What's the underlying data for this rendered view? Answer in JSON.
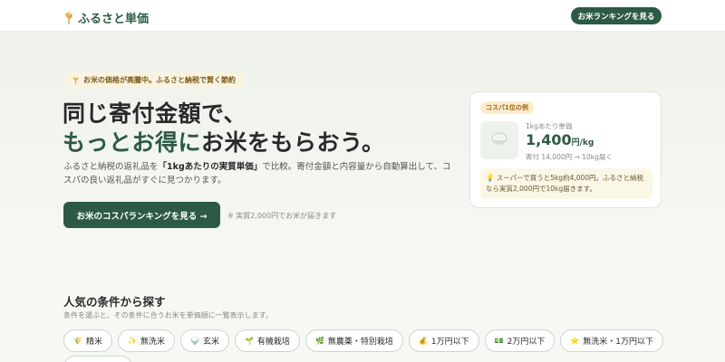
{
  "header": {
    "logo_text": "ふるさと単価",
    "logo_icon": "rice-plant-icon",
    "cta_label": "お米ランキングを見る"
  },
  "hero": {
    "notice": "お米の価格が高騰中。ふるさと納税で賢く節約",
    "headline_line1": "同じ寄付金額で、",
    "headline_line2_green": "もっとお得に",
    "headline_line2_dark": "お米をもらおう。",
    "desc_pre": "ふるさと納税の返礼品を",
    "desc_bold": "「1kgあたりの実質単価」",
    "desc_post": "で比較。寄付金額と内容量から自動算出して、コスパの良い返礼品がすぐに見つかります。",
    "cta_label": "お米のコスパランキングを見る →",
    "cta_note": "※ 実質2,000円でお米が届きます"
  },
  "card": {
    "badge": "コスパ1位の例",
    "sublabel": "1kgあたり単価",
    "price_number": "1,400",
    "price_unit": "円/kg",
    "detail": "寄付 14,000円 → 10kg届く",
    "note": "💡 スーパーで買うと5kg約4,000円。ふるさと納税なら実質2,000円で10kg届きます。"
  },
  "conditions": {
    "title": "人気の条件から探す",
    "desc": "条件を選ぶと、その条件に合うお米を単価順に一覧表示します。",
    "chips": [
      {
        "icon": "🌾",
        "label": "精米"
      },
      {
        "icon": "✨",
        "label": "無洗米"
      },
      {
        "icon": "🍚",
        "label": "玄米"
      },
      {
        "icon": "🌱",
        "label": "有機栽培"
      },
      {
        "icon": "🌿",
        "label": "無農薬・特別栽培"
      },
      {
        "icon": "💰",
        "label": "1万円以下"
      },
      {
        "icon": "💵",
        "label": "2万円以下"
      },
      {
        "icon": "⭐",
        "label": "無洗米・1万円以下"
      }
    ]
  },
  "colors": {
    "brand_green": "#2c5a45",
    "accent_yellow": "#fbeccc"
  }
}
